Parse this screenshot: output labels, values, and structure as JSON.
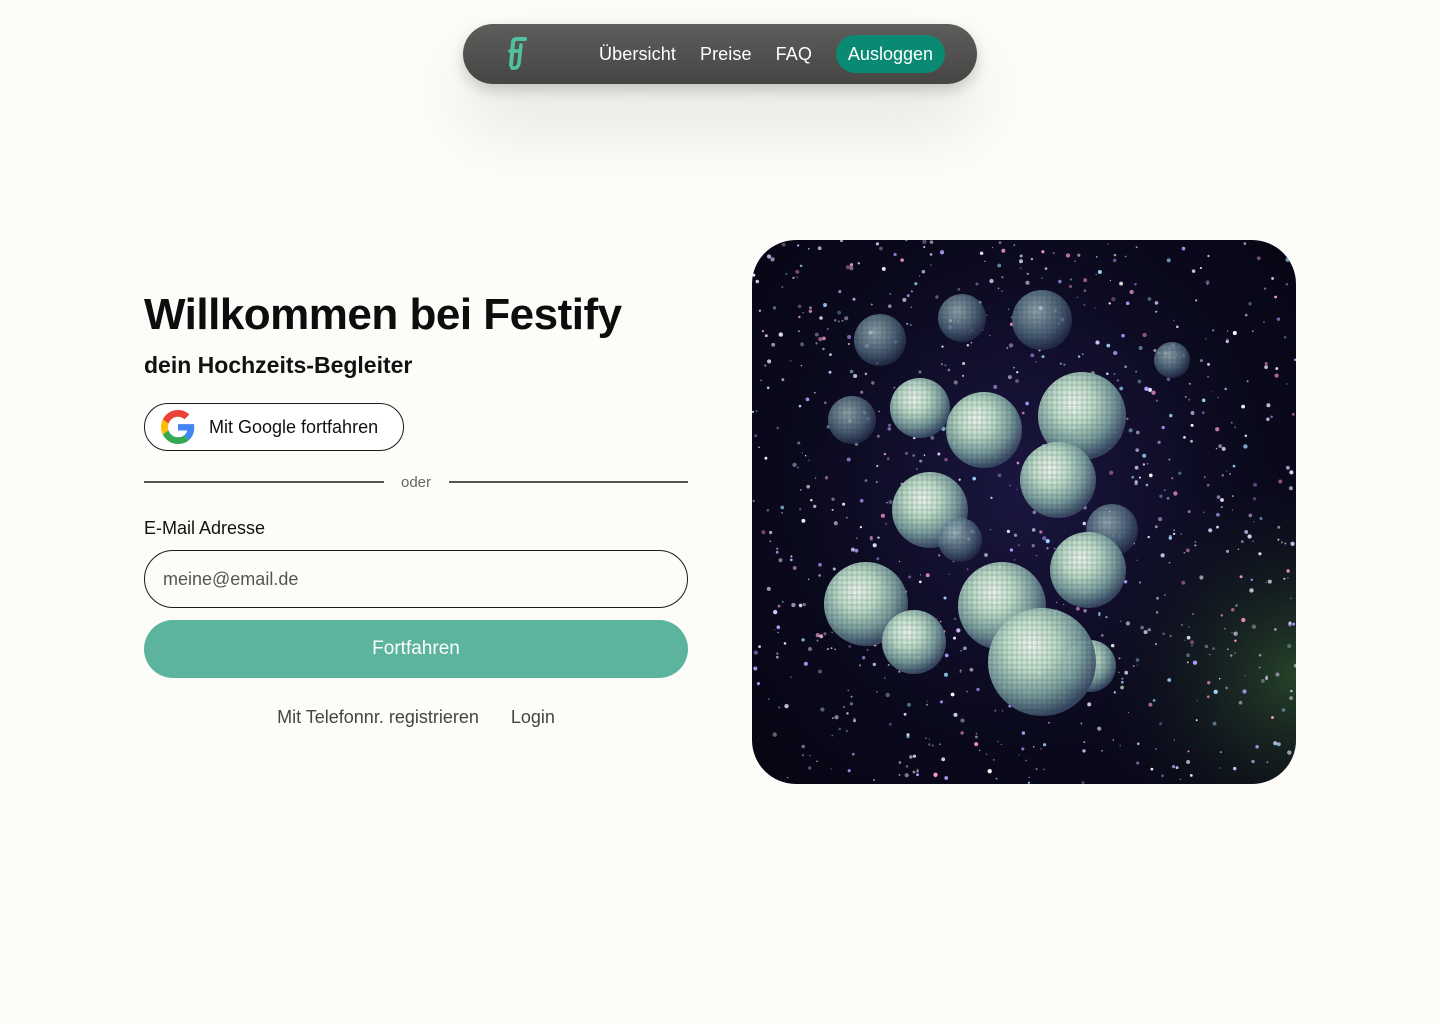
{
  "nav": {
    "logo_alt": "festify-logo",
    "links": [
      {
        "label": "Übersicht"
      },
      {
        "label": "Preise"
      },
      {
        "label": "FAQ"
      }
    ],
    "logout_label": "Ausloggen",
    "accent": "#0b8a73"
  },
  "welcome": {
    "title": "Willkommen bei Festify",
    "subtitle": "dein Hochzeits-Begleiter"
  },
  "google": {
    "label": "Mit Google fortfahren",
    "icon": "google-icon"
  },
  "divider": {
    "text": "oder"
  },
  "email": {
    "label": "E-Mail Adresse",
    "placeholder": "meine@email.de",
    "value": ""
  },
  "continue": {
    "label": "Fortfahren",
    "color": "#5cb49f"
  },
  "alt_links": {
    "phone_label": "Mit Telefonnr. registrieren",
    "login_label": "Login"
  },
  "hero": {
    "icon": "disco-balls-photo"
  }
}
